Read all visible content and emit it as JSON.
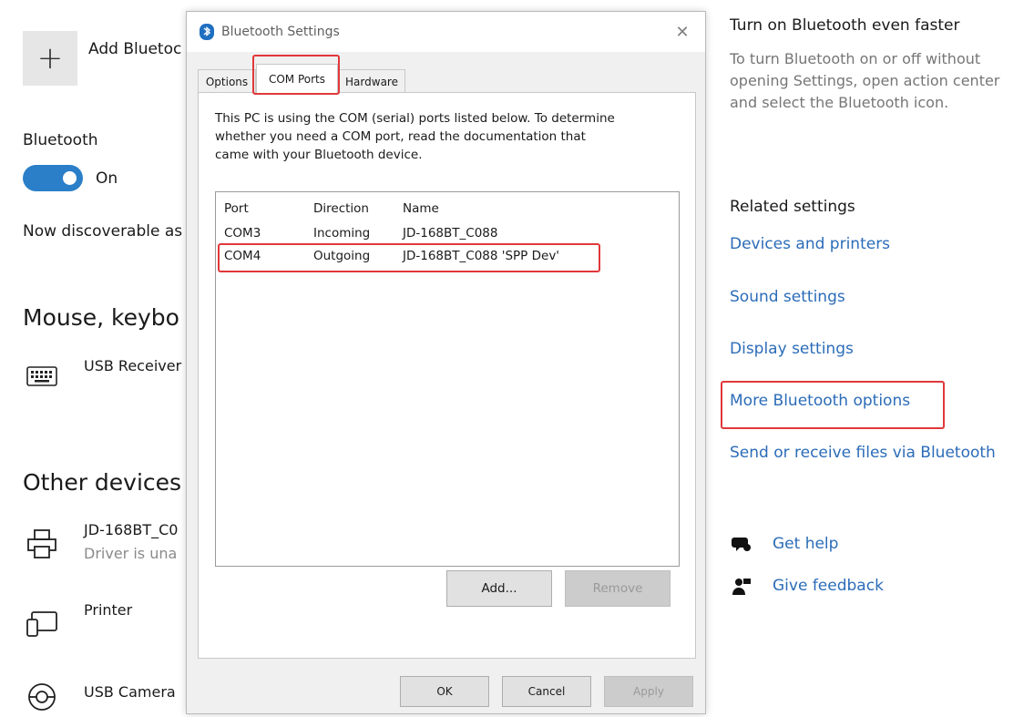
{
  "settings": {
    "add_label": "Add Bluetoc",
    "bluetooth_heading": "Bluetooth",
    "toggle_state": "On",
    "discoverable": "Now discoverable as",
    "mouse_heading": "Mouse, keybo",
    "mouse_devices": [
      {
        "name": "USB Receiver",
        "icon": "keyboard-icon"
      }
    ],
    "other_heading": "Other devices",
    "other_devices": [
      {
        "name": "JD-168BT_C0",
        "status": "Driver is una",
        "icon": "printer-icon"
      },
      {
        "name": "Printer",
        "status": "",
        "icon": "devices-icon"
      },
      {
        "name": "USB Camera",
        "status": "",
        "icon": "camera-icon"
      }
    ]
  },
  "right": {
    "title": "Turn on Bluetooth even faster",
    "description": "To turn Bluetooth on or off without opening Settings, open action center and select the Bluetooth icon.",
    "related_heading": "Related settings",
    "links": [
      "Devices and printers",
      "Sound settings",
      "Display settings",
      "More Bluetooth options",
      "Send or receive files via Bluetooth"
    ],
    "help": [
      {
        "label": "Get help",
        "icon": "help-chat-icon"
      },
      {
        "label": "Give feedback",
        "icon": "feedback-icon"
      }
    ]
  },
  "dialog": {
    "title": "Bluetooth Settings",
    "tabs": [
      "Options",
      "COM Ports",
      "Hardware"
    ],
    "active_tab": "COM Ports",
    "description": "This PC is using the COM (serial) ports listed below. To determine whether you need a COM port, read the documentation that came with your Bluetooth device.",
    "columns": [
      "Port",
      "Direction",
      "Name"
    ],
    "rows": [
      {
        "port": "COM3",
        "direction": "Incoming",
        "name": "JD-168BT_C088"
      },
      {
        "port": "COM4",
        "direction": "Outgoing",
        "name": "JD-168BT_C088 'SPP Dev'"
      }
    ],
    "buttons": {
      "add": "Add...",
      "remove": "Remove",
      "ok": "OK",
      "cancel": "Cancel",
      "apply": "Apply"
    }
  },
  "colors": {
    "accent": "#2a7fc8",
    "link": "#2b6cb8",
    "highlight": "#e0383a"
  }
}
